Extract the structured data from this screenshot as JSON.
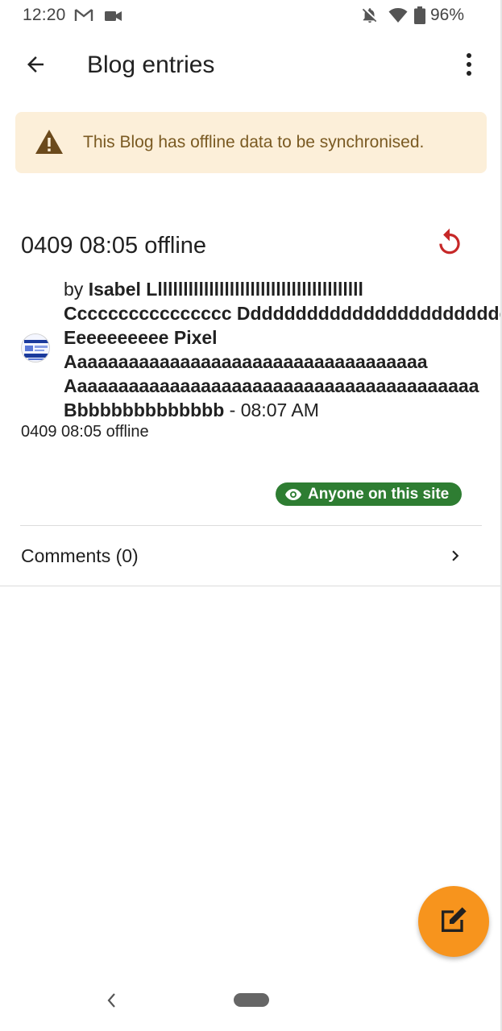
{
  "status_bar": {
    "time": "12:20",
    "battery_percent": "96%",
    "icons": [
      "gmail-icon",
      "video-camera-icon",
      "notifications-off-icon",
      "wifi-icon",
      "battery-icon"
    ]
  },
  "app_bar": {
    "title": "Blog entries",
    "back_icon": "arrow-back-icon",
    "menu_icon": "more-vert-icon"
  },
  "warning": {
    "text": "This Blog has offline data to be synchronised.",
    "icon": "warning-icon",
    "background": "#fcefd9",
    "text_color": "#7a5a22"
  },
  "entry": {
    "title": "0409 08:05 offline",
    "undo_icon": "undo-icon",
    "by_prefix": "by ",
    "author_line1": "Isabel Lllllllllllllllllllllllllllllllllllllllll",
    "author_line2": "Cccccccccccccccc Ddddddddddddddddddddddddd",
    "author_line3": "Eeeeeeeeee Pixel",
    "author_line4": "Aaaaaaaaaaaaaaaaaaaaaaaaaaaaaaaaaaa",
    "author_line5": "Aaaaaaaaaaaaaaaaaaaaaaaaaaaaaaaaaaaaaaaa",
    "author_line6": "Bbbbbbbbbbbbbb",
    "time_separator": " - ",
    "time": "08:07 AM",
    "subject": "0409 08:05 offline",
    "visibility_label": "Anyone on this site",
    "visibility_color": "#2e7d32"
  },
  "comments": {
    "label": "Comments (0)",
    "chevron_icon": "chevron-right-icon"
  },
  "fab": {
    "icon": "edit-icon",
    "color": "#f7941d"
  },
  "nav": {
    "back_icon": "nav-back-icon"
  }
}
